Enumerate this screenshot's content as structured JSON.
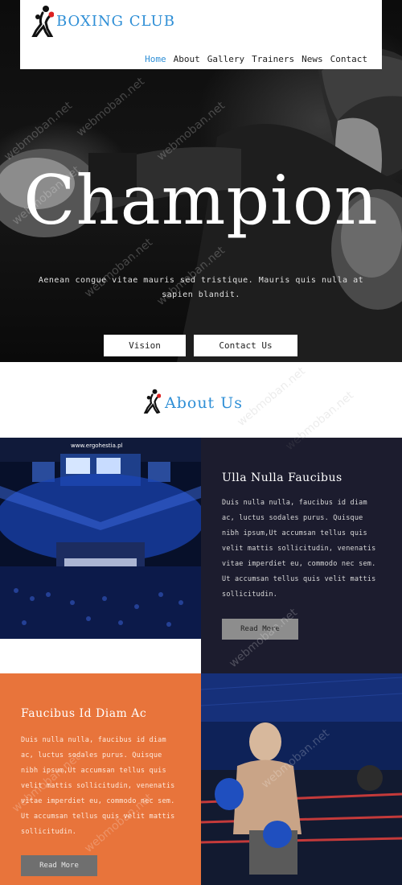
{
  "brand": {
    "name": "BOXING CLUB",
    "logo_icon": "boxer-icon"
  },
  "nav": {
    "items": [
      {
        "label": "Home",
        "active": true
      },
      {
        "label": "About",
        "active": false
      },
      {
        "label": "Gallery",
        "active": false
      },
      {
        "label": "Trainers",
        "active": false
      },
      {
        "label": "News",
        "active": false
      },
      {
        "label": "Contact",
        "active": false
      }
    ]
  },
  "hero": {
    "title": "Champion",
    "subtitle": "Aenean congue vitae mauris sed tristique. Mauris quis nulla at sapien blandit.",
    "buttons": {
      "vision": "Vision",
      "contact": "Contact Us"
    }
  },
  "about": {
    "title": "About Us",
    "icon": "boxer-icon"
  },
  "cards": [
    {
      "title": "Ulla Nulla Faucibus",
      "body": "Duis nulla nulla, faucibus id diam ac, luctus sodales purus. Quisque nibh ipsum,Ut accumsan tellus quis velit mattis sollicitudin, venenatis vitae imperdiet eu, commodo nec sem. Ut accumsan tellus quis velit mattis sollicitudin.",
      "button": "Read More"
    },
    {
      "title": "Faucibus Id Diam Ac",
      "body": "Duis nulla nulla, faucibus id diam ac, luctus sodales purus. Quisque nibh ipsum,Ut accumsan tellus quis velit mattis sollicitudin, venenatis vitae imperdiet eu, commodo nec sem. Ut accumsan tellus quis velit mattis sollicitudin.",
      "button": "Read More"
    }
  ],
  "arena_sign": "www.ergohestia.pl",
  "watermark": "webmoban.net",
  "colors": {
    "accent": "#2f8fd6",
    "dark_panel": "#1c1c2e",
    "orange_panel": "#e8743b"
  }
}
